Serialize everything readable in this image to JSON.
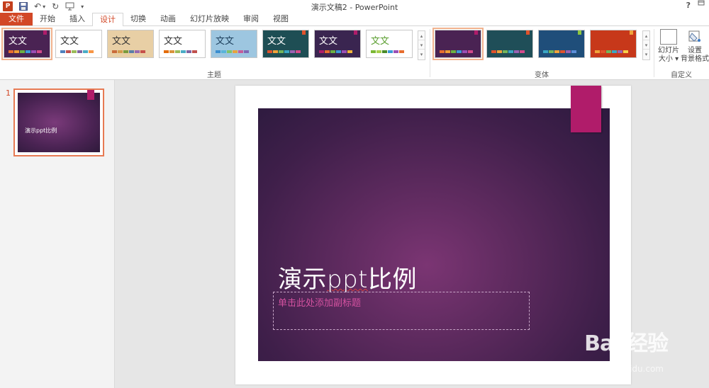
{
  "window": {
    "title": "演示文稿2 - PowerPoint",
    "help": "?",
    "app_icon": "P"
  },
  "qat": {
    "save": "save-icon",
    "undo": "↶",
    "undo_dropdown": "▾",
    "redo": "↻",
    "from_beginning": "slideshow-icon",
    "customize": "▾"
  },
  "tabs": [
    "文件",
    "开始",
    "插入",
    "设计",
    "切换",
    "动画",
    "幻灯片放映",
    "审阅",
    "视图"
  ],
  "active_tab": "设计",
  "themes": {
    "label": "主题",
    "items": [
      {
        "text": "文文",
        "bg": "#4a2353",
        "fg": "#ffffff",
        "flag": "#b01c6a",
        "bars": [
          "#e76d2e",
          "#ef9d35",
          "#6cb143",
          "#3b9ad7",
          "#9a4fb5",
          "#d24a8b"
        ],
        "selected": true
      },
      {
        "text": "文文",
        "bg": "#ffffff",
        "fg": "#333333",
        "flag": "",
        "bars": [
          "#4f81bd",
          "#c0504d",
          "#9bbb59",
          "#8064a2",
          "#4bacc6",
          "#f79646"
        ],
        "selected": false
      },
      {
        "text": "文文",
        "bg": "#e8cfa5",
        "fg": "#333333",
        "flag": "",
        "bars": [
          "#c96b3a",
          "#d39a4b",
          "#7a9b3d",
          "#5a7fa8",
          "#9a6ab0",
          "#c6504a"
        ],
        "selected": false
      },
      {
        "text": "文文",
        "bg": "#ffffff",
        "fg": "#333333",
        "flag": "",
        "bars": [
          "#e36c0a",
          "#d9933c",
          "#9bbb59",
          "#4bacc6",
          "#8064a2",
          "#c0504d"
        ],
        "selected": false
      },
      {
        "text": "文文",
        "bg": "#9dc6e0",
        "fg": "#1d3e5b",
        "flag": "",
        "bars": [
          "#3b8ed0",
          "#59b4d9",
          "#7fc36a",
          "#e8a33d",
          "#c65c9a",
          "#7d68b5"
        ],
        "selected": false
      },
      {
        "text": "文文",
        "bg": "#1e4e54",
        "fg": "#ffffff",
        "flag": "#e0532c",
        "bars": [
          "#e0532c",
          "#f0a33a",
          "#73b55b",
          "#3aa6c4",
          "#9a62b3",
          "#d24a8b"
        ],
        "selected": false
      },
      {
        "text": "文文",
        "bg": "#3a2550",
        "fg": "#ffffff",
        "flag": "#b01c6a",
        "bars": [
          "#b01c6a",
          "#e76d2e",
          "#6cb143",
          "#3b9ad7",
          "#9a4fb5",
          "#f0b43a"
        ],
        "selected": false
      },
      {
        "text": "文文",
        "bg": "#ffffff",
        "fg": "#5a9e2f",
        "flag": "",
        "bars": [
          "#7bb834",
          "#a6cf4a",
          "#4a8b2a",
          "#3b9ad7",
          "#9a4fb5",
          "#e76d2e"
        ],
        "selected": false
      }
    ]
  },
  "variants": {
    "label": "变体",
    "items": [
      {
        "bg": "#4a2353",
        "flag": "#b01c6a",
        "bars": [
          "#e76d2e",
          "#ef9d35",
          "#6cb143",
          "#3b9ad7",
          "#9a4fb5",
          "#d24a8b"
        ],
        "selected": true
      },
      {
        "bg": "#1f4e58",
        "flag": "#e0532c",
        "bars": [
          "#e0532c",
          "#f0a33a",
          "#73b55b",
          "#3aa6c4",
          "#9a62b3",
          "#d24a8b"
        ],
        "selected": false
      },
      {
        "bg": "#1f4e7a",
        "flag": "#8dc63f",
        "bars": [
          "#3aa6c4",
          "#73b55b",
          "#f0a33a",
          "#e0532c",
          "#9a62b3",
          "#5b8ed8"
        ],
        "selected": false
      },
      {
        "bg": "#c7381a",
        "flag": "#f0a33a",
        "bars": [
          "#f0a33a",
          "#e0532c",
          "#73b55b",
          "#3aa6c4",
          "#9a62b3",
          "#f7d04a"
        ],
        "selected": false
      }
    ]
  },
  "customize": {
    "label": "自定义",
    "slide_size": [
      "幻灯片",
      "大小 ▾"
    ],
    "bg_format": [
      "设置",
      "背景格式"
    ]
  },
  "slides_pane": {
    "number": "1",
    "thumb_title": "演示ppt比例"
  },
  "slide": {
    "title_part1": "演示",
    "title_underlined": "ppt",
    "title_part2": "比例",
    "subtitle_placeholder": "单击此处添加副标题"
  },
  "watermark": {
    "brand": "Bai 经验",
    "url": "jingyan.baidu.com"
  }
}
